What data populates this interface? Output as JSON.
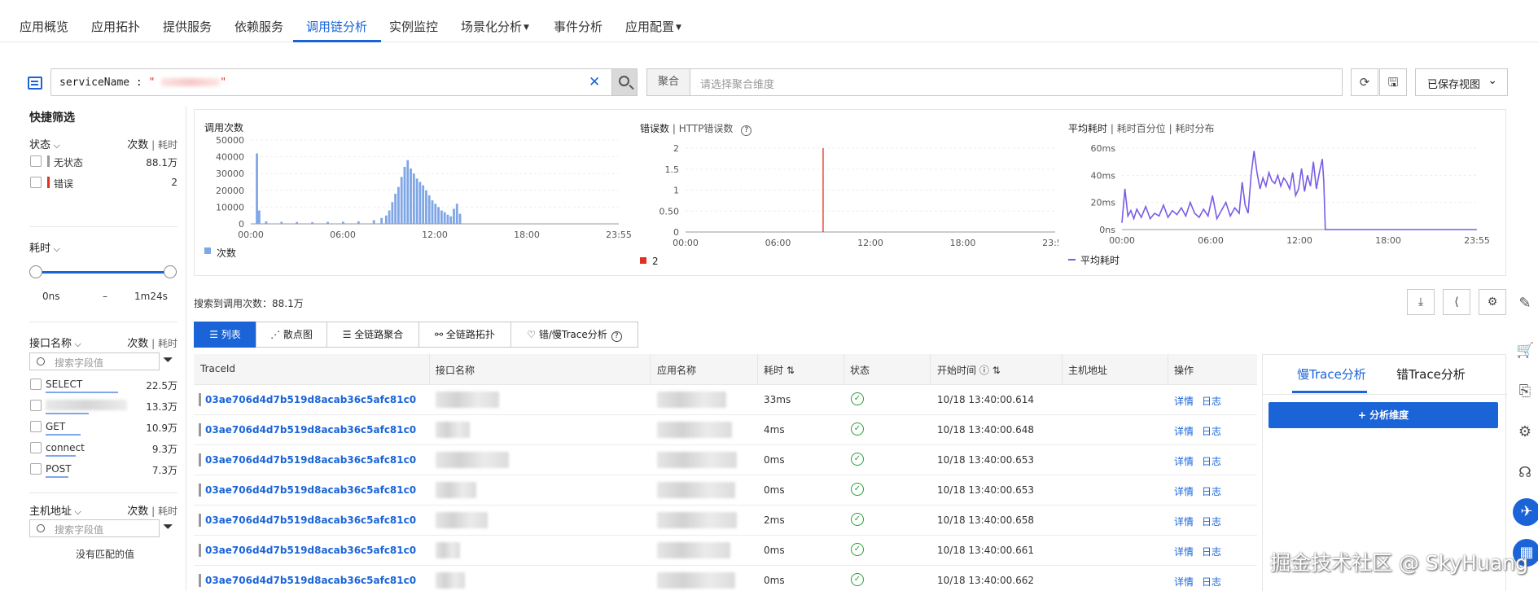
{
  "top_tabs": [
    {
      "label": "应用概览"
    },
    {
      "label": "应用拓扑"
    },
    {
      "label": "提供服务"
    },
    {
      "label": "依赖服务"
    },
    {
      "label": "调用链分析",
      "active": true
    },
    {
      "label": "实例监控"
    },
    {
      "label": "场景化分析",
      "dropdown": true
    },
    {
      "label": "事件分析"
    },
    {
      "label": "应用配置",
      "dropdown": true
    }
  ],
  "search": {
    "query_key": "serviceName : ",
    "query_value": "\"  ",
    "query_value_end": "\"",
    "clear_icon": "close-icon",
    "search_icon": "search-icon"
  },
  "aggregate": {
    "label": "聚合",
    "placeholder": "请选择聚合维度"
  },
  "saved_view": {
    "label": "已保存视图"
  },
  "quick_filter": {
    "title": "快捷筛选",
    "status": {
      "header": "状态",
      "right_main": "次数",
      "right_sub": "耗时",
      "items": [
        {
          "label": "无状态",
          "value": "88.1万",
          "color": "#999999"
        },
        {
          "label": "错误",
          "value": "2",
          "color": "#e0301e"
        }
      ]
    },
    "duration": {
      "header": "耗时",
      "min_label": "0ns",
      "dash": "–",
      "max_label": "1m24s"
    },
    "interface": {
      "header": "接口名称",
      "right_main": "次数",
      "right_sub": "耗时",
      "placeholder": "搜索字段值",
      "items": [
        {
          "label": "SELECT",
          "value": "22.5万",
          "share": 0.85
        },
        {
          "label": "",
          "value": "13.3万",
          "share": 0.5,
          "blurred": true
        },
        {
          "label": "GET",
          "value": "10.9万",
          "share": 0.41
        },
        {
          "label": "connect",
          "value": "9.3万",
          "share": 0.35
        },
        {
          "label": "POST",
          "value": "7.3万",
          "share": 0.27
        }
      ]
    },
    "host": {
      "header": "主机地址",
      "right_main": "次数",
      "right_sub": "耗时",
      "placeholder": "搜索字段值",
      "empty": "没有匹配的值"
    }
  },
  "charts": {
    "calls": {
      "title": "调用次数",
      "legend": "次数"
    },
    "errors": {
      "title_main": "错误数",
      "title_sep": "|",
      "title_alt": "HTTP错误数",
      "legend": "2"
    },
    "latency": {
      "title_main": "平均耗时",
      "sep1": "|",
      "alt1": "耗时百分位",
      "sep2": "|",
      "alt2": "耗时分布",
      "legend": "平均耗时"
    }
  },
  "chart_data": [
    {
      "type": "bar",
      "title": "调用次数",
      "xticks": [
        "00:00",
        "06:00",
        "12:00",
        "18:00",
        "23:55"
      ],
      "yticks": [
        "50000",
        "40000",
        "30000",
        "20000",
        "10000",
        "0"
      ],
      "ylim": [
        0,
        50000
      ],
      "series": [
        {
          "name": "次数",
          "color": "#7fa6e6"
        }
      ],
      "x_hours": [
        0.4,
        0.55,
        1.0,
        2.0,
        3.0,
        4.0,
        5.0,
        6.0,
        7.0,
        8.0,
        8.5,
        8.8,
        9.0,
        9.2,
        9.4,
        9.6,
        9.8,
        10.0,
        10.2,
        10.4,
        10.6,
        10.8,
        11.0,
        11.2,
        11.4,
        11.6,
        11.8,
        12.0,
        12.2,
        12.4,
        12.6,
        12.8,
        13.0,
        13.2,
        13.4,
        13.6
      ],
      "values": [
        42000,
        8000,
        1500,
        1200,
        1100,
        1000,
        1200,
        1300,
        1500,
        2200,
        3500,
        5000,
        8000,
        13000,
        18000,
        22000,
        28000,
        34000,
        38000,
        33000,
        30000,
        27000,
        25000,
        23000,
        20000,
        17000,
        14000,
        12000,
        10000,
        8000,
        7000,
        5500,
        4500,
        9000,
        12000,
        6000
      ]
    },
    {
      "type": "line",
      "title": "错误数",
      "xticks": [
        "00:00",
        "06:00",
        "12:00",
        "18:00",
        "23:55"
      ],
      "yticks": [
        "2",
        "1.5",
        "1",
        "0.50",
        "0"
      ],
      "ylim": [
        0,
        2
      ],
      "series": [
        {
          "name": "2",
          "color": "#e0301e",
          "x_hours": [
            8.9,
            8.9
          ],
          "values": [
            0,
            2
          ]
        }
      ]
    },
    {
      "type": "line",
      "title": "平均耗时",
      "xticks": [
        "00:00",
        "06:00",
        "12:00",
        "18:00",
        "23:55"
      ],
      "yticks": [
        "60ms",
        "40ms",
        "20ms",
        "0ns"
      ],
      "ylim": [
        0,
        60
      ],
      "series": [
        {
          "name": "平均耗时",
          "color": "#7a5ce6",
          "x_hours": [
            0,
            0.2,
            0.4,
            0.6,
            0.8,
            1,
            1.3,
            1.6,
            1.9,
            2.2,
            2.5,
            2.8,
            3.1,
            3.4,
            3.7,
            4,
            4.3,
            4.6,
            4.9,
            5.2,
            5.5,
            5.8,
            6.1,
            6.4,
            6.7,
            7.0,
            7.3,
            7.6,
            7.9,
            8.1,
            8.3,
            8.5,
            8.7,
            8.9,
            9.1,
            9.3,
            9.5,
            9.7,
            9.9,
            10.1,
            10.3,
            10.5,
            10.7,
            10.9,
            11.1,
            11.3,
            11.5,
            11.7,
            11.9,
            12.1,
            12.3,
            12.5,
            12.7,
            12.9,
            13.1,
            13.3,
            13.5,
            13.6,
            13.7,
            18,
            23.9
          ],
          "values": [
            5,
            30,
            10,
            14,
            8,
            15,
            9,
            17,
            8,
            12,
            10,
            18,
            9,
            14,
            11,
            16,
            10,
            20,
            12,
            9,
            15,
            10,
            25,
            8,
            14,
            20,
            10,
            16,
            12,
            35,
            18,
            12,
            40,
            58,
            42,
            30,
            38,
            32,
            42,
            36,
            34,
            40,
            32,
            38,
            35,
            30,
            42,
            25,
            30,
            45,
            28,
            40,
            32,
            50,
            30,
            42,
            52,
            35,
            0,
            0,
            0
          ]
        }
      ]
    }
  ],
  "results": {
    "label": "搜索到调用次数：88.1万"
  },
  "tool_buttons": [
    "download-icon",
    "share-icon",
    "settings-icon"
  ],
  "view_tabs": [
    {
      "label": "列表",
      "active": true
    },
    {
      "label": "散点图"
    },
    {
      "label": "全链路聚合"
    },
    {
      "label": "全链路拓扑"
    },
    {
      "label": "错/慢Trace分析"
    }
  ],
  "table": {
    "headers": [
      "TraceId",
      "接口名称",
      "应用名称",
      "耗时",
      "状态",
      "开始时间",
      "主机地址",
      "操作"
    ],
    "detail_label": "详情",
    "log_label": "日志",
    "rows": [
      {
        "trace_id": "03ae706d4d7b519d8acab36c5afc81c0",
        "duration": "33ms",
        "start": "10/18 13:40:00.614"
      },
      {
        "trace_id": "03ae706d4d7b519d8acab36c5afc81c0",
        "duration": "4ms",
        "start": "10/18 13:40:00.648"
      },
      {
        "trace_id": "03ae706d4d7b519d8acab36c5afc81c0",
        "duration": "0ms",
        "start": "10/18 13:40:00.653"
      },
      {
        "trace_id": "03ae706d4d7b519d8acab36c5afc81c0",
        "duration": "0ms",
        "start": "10/18 13:40:00.653"
      },
      {
        "trace_id": "03ae706d4d7b519d8acab36c5afc81c0",
        "duration": "2ms",
        "start": "10/18 13:40:00.658"
      },
      {
        "trace_id": "03ae706d4d7b519d8acab36c5afc81c0",
        "duration": "0ms",
        "start": "10/18 13:40:00.661"
      },
      {
        "trace_id": "03ae706d4d7b519d8acab36c5afc81c0",
        "duration": "0ms",
        "start": "10/18 13:40:00.662"
      }
    ]
  },
  "right_panel": {
    "tab_slow": "慢Trace分析",
    "tab_error": "错Trace分析",
    "add_button": "+ 分析维度"
  },
  "watermark": "掘金技术社区 @ SkyHuang"
}
